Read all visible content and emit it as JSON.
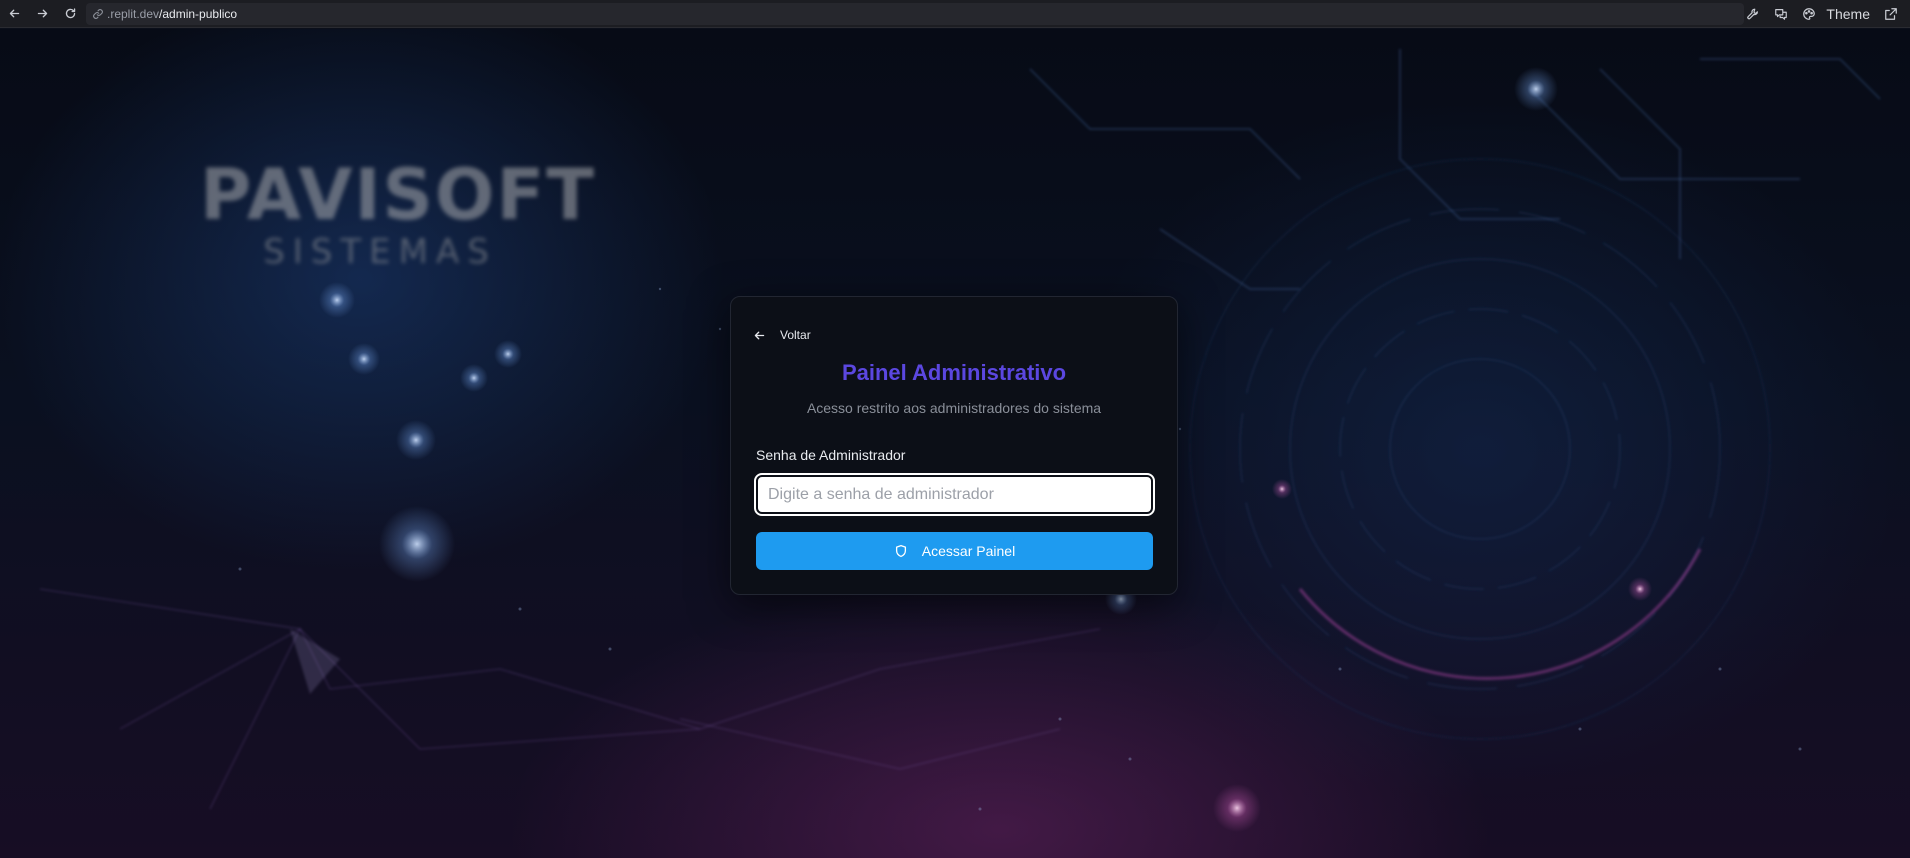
{
  "browser": {
    "url_host": ".replit.dev",
    "url_path": "/admin-publico",
    "theme_label": "Theme"
  },
  "background": {
    "logo_main": "PAVISOFT",
    "logo_sub": "SISTEMAS"
  },
  "login": {
    "back_label": "Voltar",
    "title": "Painel Administrativo",
    "subtitle": "Acesso restrito aos administradores do sistema",
    "password_label": "Senha de Administrador",
    "password_placeholder": "Digite a senha de administrador",
    "password_value": "",
    "submit_label": "Acessar Painel"
  },
  "colors": {
    "title": "#5b47e0",
    "button": "#1e9bf0",
    "card": "#0c0f17"
  },
  "icons": {
    "back": "arrow-left-icon",
    "forward": "arrow-right-icon",
    "reload": "reload-icon",
    "link": "link-icon",
    "tools": "wrench-icon",
    "chat": "chat-icon",
    "theme": "palette-icon",
    "open": "external-link-icon",
    "submit": "shield-icon"
  }
}
